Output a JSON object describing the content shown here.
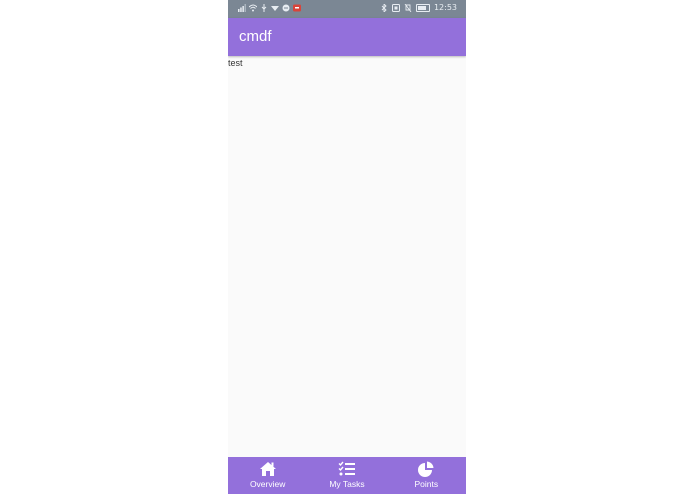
{
  "status_bar": {
    "time": "12:53",
    "left_icons": [
      "signal-icon",
      "wifi-icon",
      "usb-icon",
      "vpn-icon",
      "notification-icon",
      "app-badge-icon"
    ],
    "right_icons": [
      "bluetooth-icon",
      "nfc-icon",
      "silent-icon",
      "battery-icon"
    ]
  },
  "app_bar": {
    "title": "cmdf"
  },
  "content": {
    "text": "test"
  },
  "bottom_nav": {
    "items": [
      {
        "label": "Overview",
        "icon": "home-icon"
      },
      {
        "label": "My Tasks",
        "icon": "task-list-icon"
      },
      {
        "label": "Points",
        "icon": "pie-chart-icon"
      }
    ]
  },
  "colors": {
    "primary": "#9370db",
    "status_bar": "#7b8794",
    "background": "#fafafa"
  }
}
